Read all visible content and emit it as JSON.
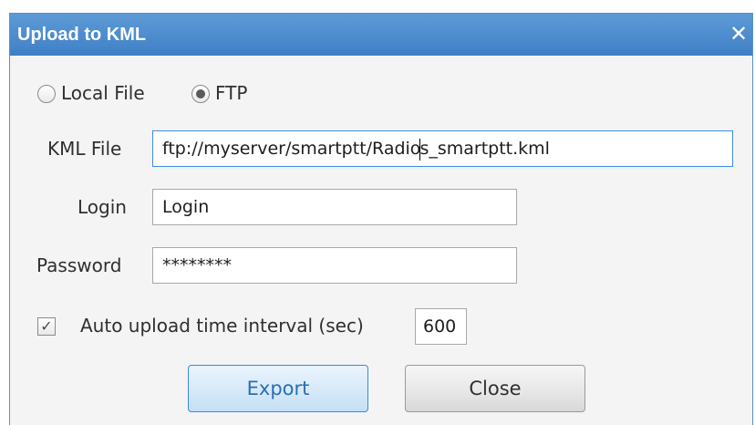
{
  "dialog": {
    "title": "Upload to KML",
    "close_glyph": "✕"
  },
  "source": {
    "local_file_label": "Local File",
    "ftp_label": "FTP",
    "selected": "FTP"
  },
  "form": {
    "kml_file_label": "KML File",
    "kml_file_value_before_caret": "ftp://myserver/smartptt/Radio",
    "kml_file_value_after_caret": "s_smartptt.kml",
    "login_label": "Login",
    "login_value": "Login",
    "password_label": "Password",
    "password_value": "********"
  },
  "auto_upload": {
    "checked": true,
    "check_glyph": "✓",
    "label": "Auto upload time interval (sec)",
    "interval_value": "600"
  },
  "buttons": {
    "export_label": "Export",
    "close_label": "Close"
  },
  "icons": {
    "close": "close-icon",
    "check": "checkmark-icon"
  },
  "colors": {
    "titlebar": "#4a8bd0",
    "focus_border": "#3d8ee6",
    "primary_button_text": "#2b6fb3"
  }
}
